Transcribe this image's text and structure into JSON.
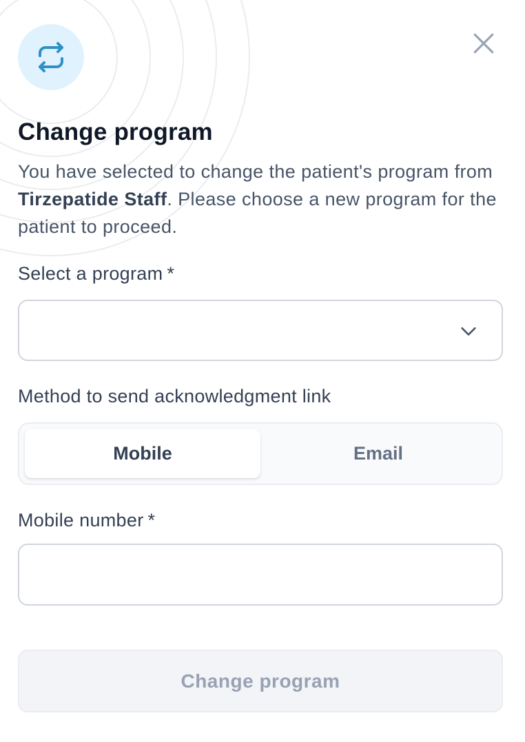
{
  "modal": {
    "title": "Change program",
    "description": {
      "prefix": "You have selected to change the patient's program from ",
      "current_program": "Tirzepatide Staff",
      "suffix": ". Please choose a new program for the patient to proceed."
    },
    "icons": {
      "feature": "switch-arrows-icon",
      "close": "close-icon",
      "select_chevron": "chevron-down-icon"
    },
    "colors": {
      "feature_icon_bg": "#e0f2fe",
      "feature_icon_fg": "#2e90c8",
      "disabled_button_bg": "#f2f4f7",
      "disabled_button_text": "#98a2b3"
    }
  },
  "program_select": {
    "label": "Select a program",
    "required_mark": "*",
    "value": ""
  },
  "method": {
    "label": "Method to send acknowledgment link",
    "options": [
      "Mobile",
      "Email"
    ],
    "selected": "Mobile"
  },
  "mobile_number": {
    "label": "Mobile number",
    "required_mark": "*",
    "value": ""
  },
  "submit": {
    "label": "Change program",
    "disabled": true
  }
}
